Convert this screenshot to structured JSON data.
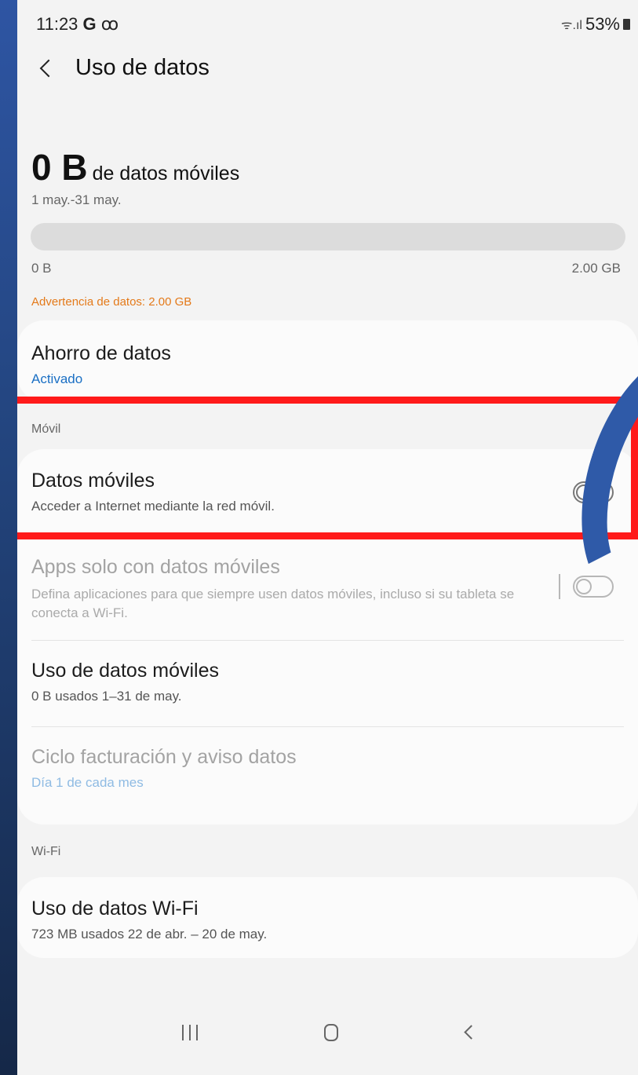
{
  "status_bar": {
    "time": "11:23",
    "carrier_icon": "G",
    "voicemail_icon": "ꝏ",
    "signal_text": "ᯤ.ıl",
    "battery": "53%"
  },
  "header": {
    "title": "Uso de datos"
  },
  "usage": {
    "value": "0 B",
    "suffix": "de datos móviles",
    "period": "1 may.-31 may.",
    "fill_fraction": 0,
    "bar_min": "0 B",
    "bar_max": "2.00 GB",
    "warning": "Advertencia de datos: 2.00 GB"
  },
  "data_saver": {
    "title": "Ahorro de datos",
    "status": "Activado"
  },
  "mobile_section": {
    "label": "Móvil",
    "items": [
      {
        "title": "Datos móviles",
        "subtitle": "Acceder a Internet mediante la red móvil.",
        "toggle": false
      },
      {
        "title": "Apps solo con datos móviles",
        "subtitle": "Defina aplicaciones para que siempre usen datos móviles, incluso si su tableta se conecta a Wi-Fi.",
        "toggle": false,
        "disabled": true
      },
      {
        "title": "Uso de datos móviles",
        "subtitle": "0 B usados 1–31 de may."
      },
      {
        "title": "Ciclo facturación y aviso datos",
        "subtitle": "Día 1 de cada mes",
        "disabled": true
      }
    ]
  },
  "wifi_section": {
    "label": "Wi-Fi",
    "items": [
      {
        "title": "Uso de datos Wi-Fi",
        "subtitle": "723 MB usados 22 de abr. – 20 de may."
      }
    ]
  },
  "colors": {
    "highlight": "#ff1a1a",
    "arrow": "#2f5aa8",
    "warning": "#e47a1a",
    "link": "#1a6fc4"
  }
}
